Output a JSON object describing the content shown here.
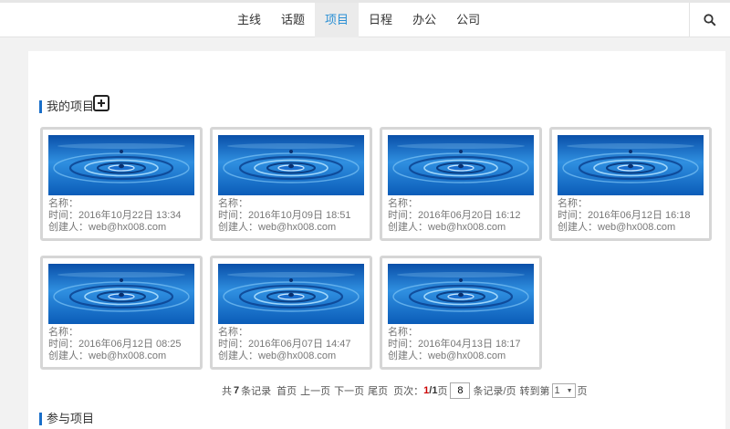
{
  "nav": {
    "items": [
      "主线",
      "话题",
      "项目",
      "日程",
      "办公",
      "公司"
    ],
    "active_index": 2,
    "active_color": "#2a8fd4",
    "search_icon": "search-icon"
  },
  "my_projects": {
    "title": "我的项目",
    "add_icon": "plus-square-icon",
    "cards": [
      {
        "name": "名称：",
        "time": "时间：2016年10月22日 13:34",
        "creator": "创建人：web@hx008.com"
      },
      {
        "name": "名称：",
        "time": "时间：2016年10月09日 18:51",
        "creator": "创建人：web@hx008.com"
      },
      {
        "name": "名称：",
        "time": "时间：2016年06月20日 16:12",
        "creator": "创建人：web@hx008.com"
      },
      {
        "name": "名称：",
        "time": "时间：2016年06月12日 16:18",
        "creator": "创建人：web@hx008.com"
      },
      {
        "name": "名称：",
        "time": "时间：2016年06月12日 08:25",
        "creator": "创建人：web@hx008.com"
      },
      {
        "name": "名称：",
        "time": "时间：2016年06月07日 14:47",
        "creator": "创建人：web@hx008.com"
      },
      {
        "name": "名称：",
        "time": "时间：2016年04月13日 18:17",
        "creator": "创建人：web@hx008.com"
      }
    ]
  },
  "pager": {
    "total_prefix": "共",
    "total": "7",
    "total_suffix": "条记录",
    "first": "首页",
    "prev": "上一页",
    "next": "下一页",
    "last": "尾页",
    "page_label": "页次：",
    "current": "1",
    "sep": "/",
    "pages": "1",
    "page_suffix": "页",
    "per_page": "8",
    "per_page_suffix": "条记录/页",
    "goto_label": "转到第",
    "goto_value": "1",
    "goto_suffix": "页"
  },
  "joined_projects": {
    "title": "参与项目"
  },
  "colors": {
    "accent": "#1a6fc9",
    "current_page": "#cc0000"
  }
}
